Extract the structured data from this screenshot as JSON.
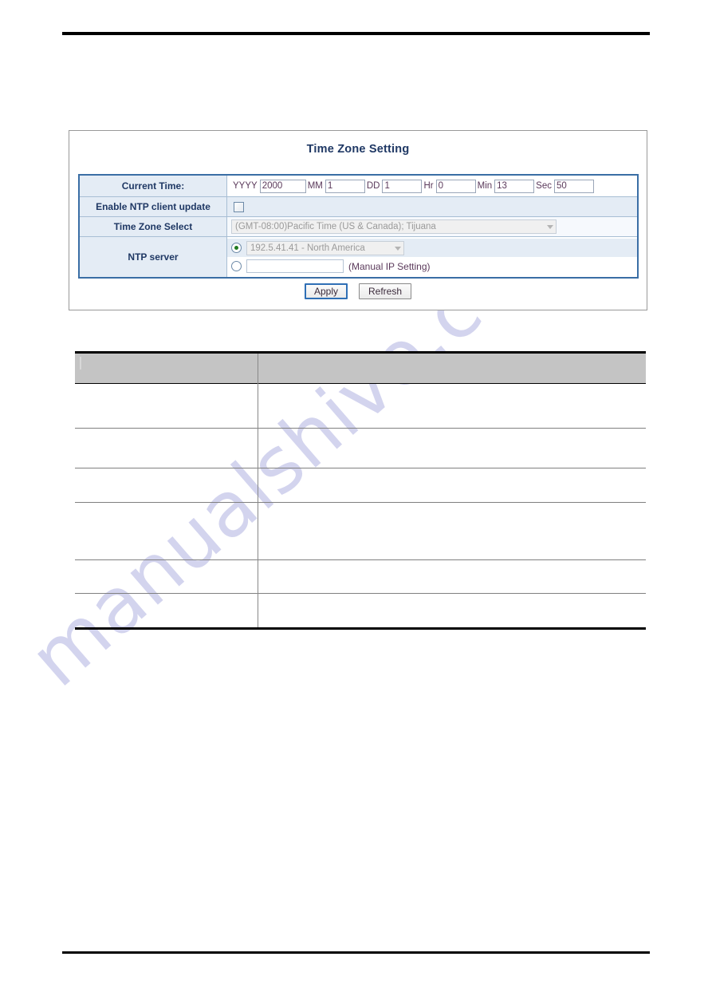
{
  "page": {
    "has_top_rule": true,
    "has_bottom_rule": true,
    "watermark_text": "manualshive.com"
  },
  "screenshot": {
    "title": "Time Zone Setting",
    "rows": {
      "current_time": {
        "label": "Current Time:",
        "fields": [
          {
            "unit": "YYYY",
            "value": "2000",
            "name": "year"
          },
          {
            "unit": "MM",
            "value": "1",
            "name": "month"
          },
          {
            "unit": "DD",
            "value": "1",
            "name": "day"
          },
          {
            "unit": "Hr",
            "value": "0",
            "name": "hour"
          },
          {
            "unit": "Min",
            "value": "13",
            "name": "minute"
          },
          {
            "unit": "Sec",
            "value": "50",
            "name": "second"
          }
        ]
      },
      "enable_ntp": {
        "label": "Enable NTP client update",
        "checked": false
      },
      "time_zone_select": {
        "label": "Time Zone Select",
        "selected": "(GMT-08:00)Pacific Time (US & Canada); Tijuana",
        "disabled": true
      },
      "ntp_server": {
        "label": "NTP server",
        "option_preset": {
          "selected": true,
          "value": "192.5.41.41 - North America",
          "disabled": true
        },
        "option_manual": {
          "selected": false,
          "value": "",
          "note": "(Manual IP Setting)"
        }
      }
    },
    "buttons": {
      "apply": "Apply",
      "refresh": "Refresh"
    },
    "colors": {
      "form_border": "#3a6ea5",
      "label_bg": "#e4ecf5",
      "title_text": "#1f3864",
      "radio_dot": "#1f7a1f"
    }
  },
  "description_table": {
    "header": {
      "col_a": "",
      "col_b": ""
    },
    "rows": [
      {
        "col_a": "",
        "col_b": ""
      },
      {
        "col_a": "",
        "col_b": ""
      },
      {
        "col_a": "",
        "col_b": ""
      },
      {
        "col_a": "",
        "col_b": ""
      },
      {
        "col_a": "",
        "col_b": ""
      },
      {
        "col_a": "",
        "col_b": ""
      }
    ]
  }
}
